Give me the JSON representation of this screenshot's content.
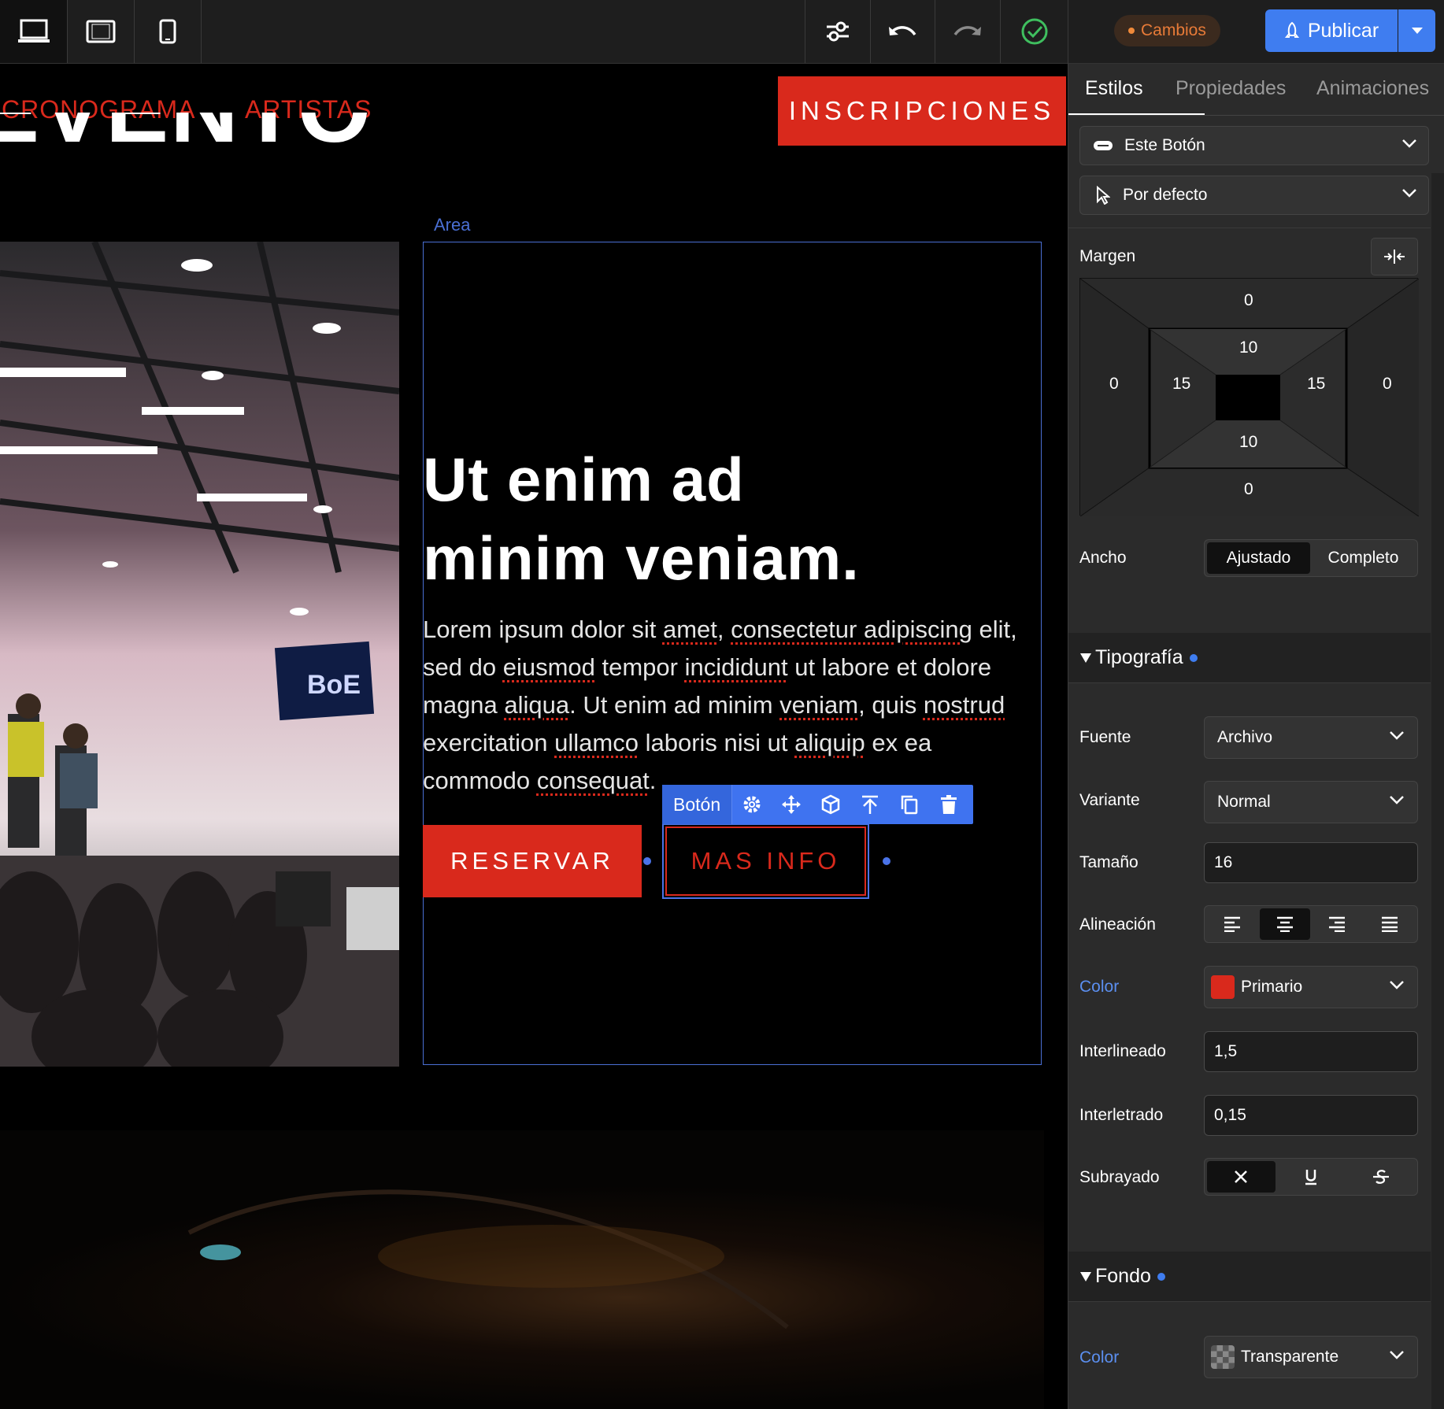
{
  "toolbar": {
    "device_icons": [
      "laptop-icon",
      "tablet-icon",
      "phone-icon"
    ],
    "action_icons": [
      "sliders-icon",
      "undo-icon",
      "redo-icon",
      "check-circle-icon"
    ]
  },
  "site": {
    "nav": [
      "CRONOGRAMA",
      "ARTISTAS"
    ],
    "cta": "INSCRIPCIONES",
    "big_title": "EVENTO",
    "area_label": "Area",
    "heading_line1": "Ut enim ad",
    "heading_line2": "minim veniam.",
    "body": {
      "p1": "Lorem ipsum dolor sit ",
      "w1": "amet",
      "p2": ", ",
      "w2": "consectetur adipiscing",
      "p3": " elit, sed do ",
      "w3": "eiusmod",
      "p4": " tempor ",
      "w4": "incididunt",
      "p5": " ut labore et dolore magna ",
      "w5": "aliqua",
      "p6": ". Ut enim ad minim ",
      "w6": "veniam",
      "p7": ", quis ",
      "w7": "nostrud",
      "p8": " exercitation ",
      "w8": "ullamco",
      "p9": " laboris nisi ut ",
      "w9": "aliquip",
      "p10": " ex ea commodo ",
      "w10": "consequat",
      "p11": "."
    },
    "button_primary": "RESERVAR",
    "button_secondary": "MAS INFO",
    "element_toolbar": {
      "label": "Botón",
      "icons": [
        "gear-icon",
        "move-icon",
        "cube-icon",
        "arrow-up-icon",
        "copy-icon",
        "trash-icon"
      ]
    }
  },
  "panel": {
    "changes_badge": "Cambios",
    "publish": "Publicar",
    "tabs": [
      "Estilos",
      "Propiedades",
      "Animaciones"
    ],
    "active_tab": "Estilos",
    "target_select": "Este Botón",
    "state_select": "Por defecto",
    "margin": {
      "label": "Margen",
      "outer_top": "0",
      "outer_left": "0",
      "outer_right": "0",
      "outer_bottom": "0",
      "inner_top": "10",
      "inner_left": "15",
      "inner_right": "15",
      "inner_bottom": "10"
    },
    "width": {
      "label": "Ancho",
      "options": [
        "Ajustado",
        "Completo"
      ],
      "selected": "Ajustado"
    },
    "typography": {
      "section": "Tipografía",
      "font_label": "Fuente",
      "font_value": "Archivo",
      "variant_label": "Variante",
      "variant_value": "Normal",
      "size_label": "Tamaño",
      "size_value": "16",
      "align_label": "Alineación",
      "align_icons": [
        "align-left-icon",
        "align-center-icon",
        "align-right-icon",
        "align-justify-icon"
      ],
      "align_selected": "center",
      "color_label": "Color",
      "color_value": "Primario",
      "color_swatch": "#d9291c",
      "line_height_label": "Interlineado",
      "line_height_value": "1,5",
      "letter_spacing_label": "Interletrado",
      "letter_spacing_value": "0,15",
      "decoration_label": "Subrayado",
      "decoration_icons": [
        "none-x-icon",
        "underline-icon",
        "strikethrough-icon"
      ],
      "decoration_selected": "none"
    },
    "background": {
      "section": "Fondo",
      "color_label": "Color",
      "color_value": "Transparente"
    }
  },
  "colors": {
    "accent": "#3f7df0",
    "brand_red": "#d9291c",
    "panel_bg": "#2b2b2b"
  }
}
